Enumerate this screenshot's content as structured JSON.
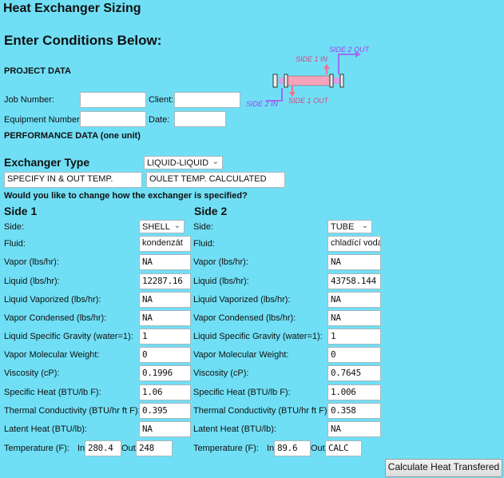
{
  "title": "Heat Exchanger Sizing",
  "heading": "Enter Conditions Below:",
  "project_data": "PROJECT DATA",
  "job_number_label": "Job Number:",
  "job_number": "",
  "client_label": "Client:",
  "client": "",
  "equipment_number_label": "Equipment Number:",
  "equipment_number": "",
  "date_label": "Date:",
  "date": "",
  "performance_data": "PERFORMANCE DATA (one unit)",
  "diagram": {
    "side2_out": "SIDE 2 OUT",
    "side1_in": "SIDE 1 IN",
    "side2_in": "SIDE 2 IN",
    "side1_out": "SIDE 1 OUT"
  },
  "exchanger_type_label": "Exchanger Type",
  "exchanger_type": "LIQUID-LIQUID",
  "spec_mode": "SPECIFY IN & OUT TEMP.",
  "spec_result": "OULET TEMP. CALCULATED",
  "question": "Would you like to change how the exchanger is specified?",
  "side1": {
    "heading": "Side 1",
    "side_label": "Side:",
    "side": "SHELL",
    "rows": [
      {
        "label": "Fluid:",
        "value": "kondenzát"
      },
      {
        "label": "Vapor (lbs/hr):",
        "value": "NA"
      },
      {
        "label": "Liquid (lbs/hr):",
        "value": "12287.16"
      },
      {
        "label": "Liquid Vaporized (lbs/hr):",
        "value": "NA"
      },
      {
        "label": "Vapor Condensed (lbs/hr):",
        "value": "NA"
      },
      {
        "label": "Liquid Specific Gravity (water=1):",
        "value": "1"
      },
      {
        "label": "Vapor Molecular Weight:",
        "value": "0"
      },
      {
        "label": "Viscosity (cP):",
        "value": "0.1996"
      },
      {
        "label": "Specific Heat (BTU/lb F):",
        "value": "1.06"
      },
      {
        "label": "Thermal Conductivity (BTU/hr ft F):",
        "value": "0.395"
      },
      {
        "label": "Latent Heat (BTU/lb):",
        "value": "NA"
      }
    ],
    "temp_label": "Temperature (F):",
    "in_label": "In",
    "temp_in": "280.4",
    "out_label": "Out",
    "temp_out": "248"
  },
  "side2": {
    "heading": "Side 2",
    "side_label": "Side:",
    "side": "TUBE",
    "rows": [
      {
        "label": "Fluid:",
        "value": "chladící voda"
      },
      {
        "label": "Vapor (lbs/hr):",
        "value": "NA"
      },
      {
        "label": "Liquid (lbs/hr):",
        "value": "43758.144"
      },
      {
        "label": "Liquid Vaporized (lbs/hr):",
        "value": "NA"
      },
      {
        "label": "Vapor Condensed (lbs/hr):",
        "value": "NA"
      },
      {
        "label": "Liquid Specific Gravity (water=1):",
        "value": "1"
      },
      {
        "label": "Vapor Molecular Weight:",
        "value": "0"
      },
      {
        "label": "Viscosity (cP):",
        "value": "0.7645"
      },
      {
        "label": "Specific Heat (BTU/lb F):",
        "value": "1.006"
      },
      {
        "label": "Thermal Conductivity (BTU/hr ft F):",
        "value": "0.358"
      },
      {
        "label": "Latent Heat (BTU/lb):",
        "value": "NA"
      }
    ],
    "temp_label": "Temperature (F):",
    "in_label": "In",
    "temp_in": "89.6",
    "out_label": "Out",
    "temp_out": "CALC"
  },
  "calculate_button": "Calculate Heat Transfered"
}
